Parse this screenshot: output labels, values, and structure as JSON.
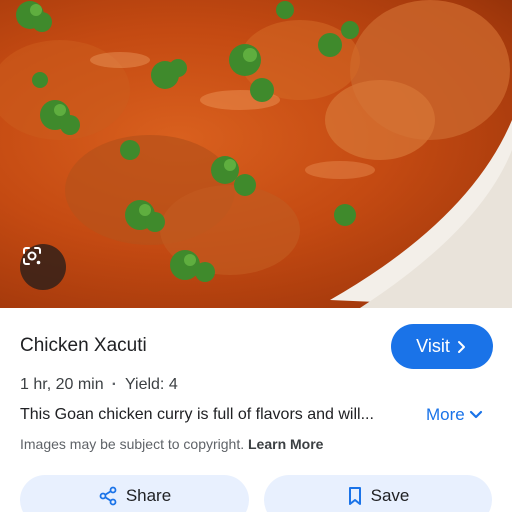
{
  "result": {
    "title": "Chicken Xacuti",
    "visit_label": "Visit",
    "duration": "1 hr, 20 min",
    "separator": "·",
    "yield": "Yield: 4",
    "description": "This Goan chicken curry is full of flavors and will...",
    "more_label": "More",
    "copyright_text": "Images may be subject to copyright.",
    "learn_more_label": "Learn More"
  },
  "actions": {
    "share_label": "Share",
    "save_label": "Save"
  },
  "icons": {
    "lens": "google-lens-icon",
    "visit_chevron": "chevron-right-icon",
    "more_chevron": "chevron-down-icon",
    "share": "share-icon",
    "save": "bookmark-icon"
  },
  "colors": {
    "accent": "#1a73e8",
    "action_bg": "#e8f0fe",
    "curry": "#c44a12"
  }
}
